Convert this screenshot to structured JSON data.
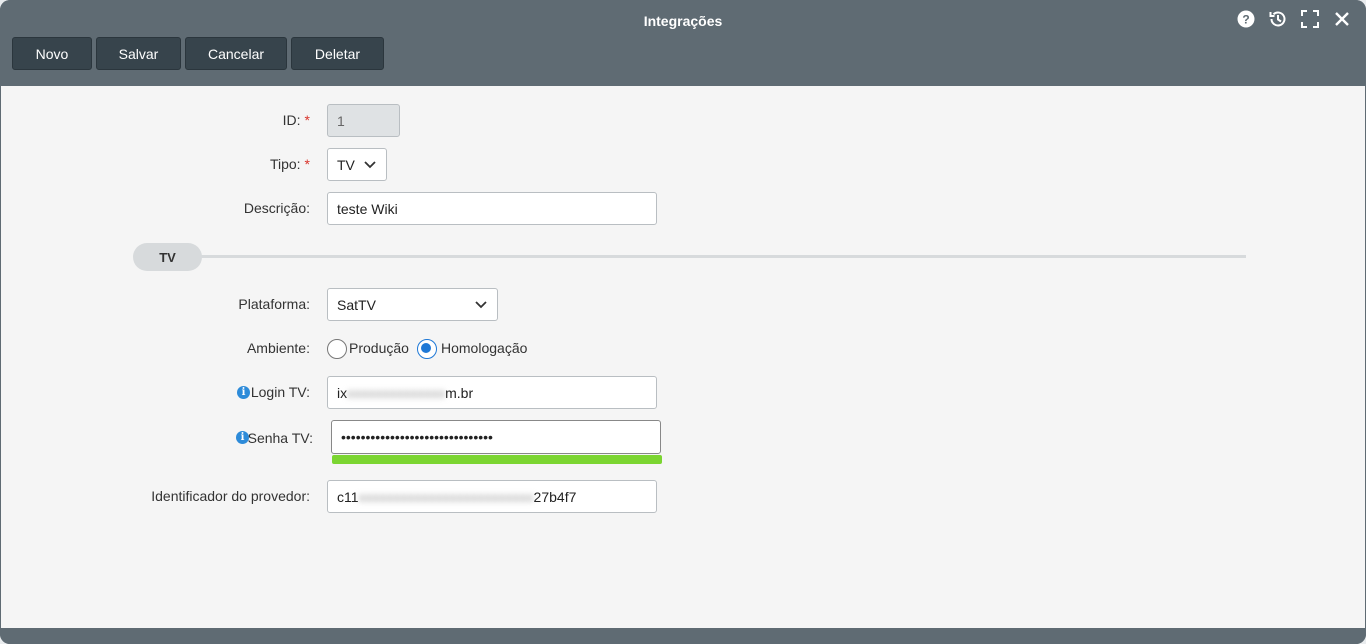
{
  "window": {
    "title": "Integrações",
    "icons": [
      "help-icon",
      "history-icon",
      "fullscreen-icon",
      "close-icon"
    ]
  },
  "toolbar": {
    "novo": "Novo",
    "salvar": "Salvar",
    "cancelar": "Cancelar",
    "deletar": "Deletar"
  },
  "form": {
    "id": {
      "label": "ID:",
      "required": "*",
      "value": "1"
    },
    "tipo": {
      "label": "Tipo:",
      "required": "*",
      "value": "TV"
    },
    "descricao": {
      "label": "Descrição:",
      "value": "teste Wiki"
    }
  },
  "section": {
    "title": "TV"
  },
  "tv": {
    "plataforma": {
      "label": "Plataforma:",
      "value": "SatTV"
    },
    "ambiente": {
      "label": "Ambiente:",
      "options": [
        "Produção",
        "Homologação"
      ],
      "selected": "Homologação"
    },
    "login": {
      "label": "Login TV:",
      "value_start": "ix",
      "value_end": "m.br"
    },
    "senha": {
      "label": "Senha TV:",
      "value": "•••••••••••••••••••••••••••••••",
      "strength": 1.0
    },
    "provedor": {
      "label": "Identificador do provedor:",
      "value_start": "c11",
      "value_end": "27b4f7"
    }
  },
  "colors": {
    "accent": "#1e78d6",
    "titlebar": "#5f6b73",
    "button": "#37444c",
    "strength": "#7bd531"
  }
}
